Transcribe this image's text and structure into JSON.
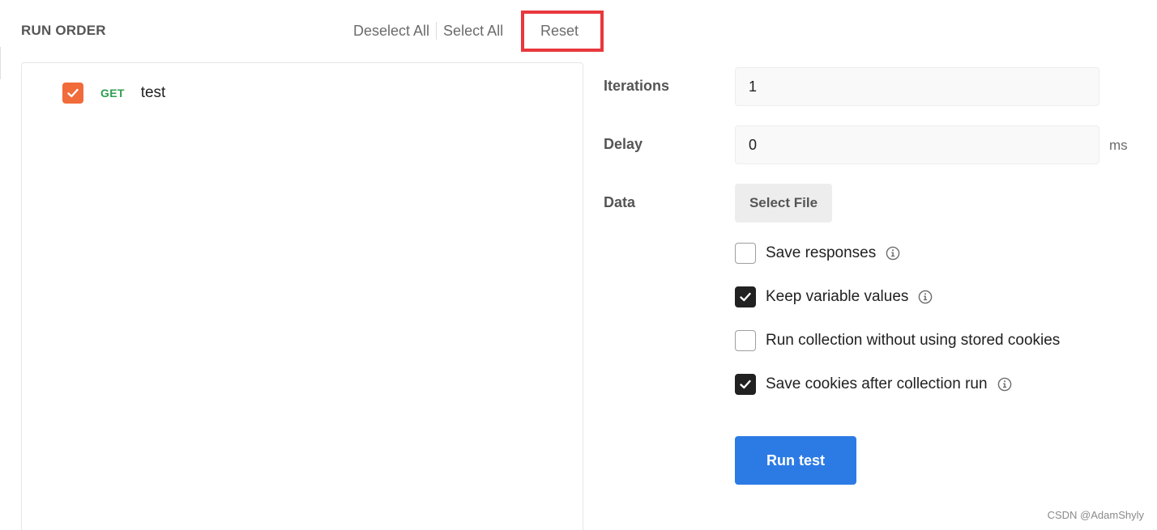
{
  "header": {
    "title": "RUN ORDER",
    "deselect_all": "Deselect All",
    "select_all": "Select All",
    "reset": "Reset"
  },
  "run_order": {
    "requests": [
      {
        "method": "GET",
        "name": "test",
        "checked": true
      }
    ]
  },
  "settings": {
    "iterations_label": "Iterations",
    "iterations_value": "1",
    "delay_label": "Delay",
    "delay_value": "0",
    "delay_unit": "ms",
    "data_label": "Data",
    "select_file": "Select File"
  },
  "options": [
    {
      "label": "Save responses",
      "checked": false,
      "info": true
    },
    {
      "label": "Keep variable values",
      "checked": true,
      "info": true
    },
    {
      "label": "Run collection without using stored cookies",
      "checked": false,
      "info": false
    },
    {
      "label": "Save cookies after collection run",
      "checked": true,
      "info": true
    }
  ],
  "run_button": "Run test",
  "watermark": "CSDN @AdamShyly",
  "colors": {
    "accent_blue": "#2c7be5",
    "orange": "#f26b3a",
    "get_green": "#2e9e4f",
    "highlight_red": "#e8383d"
  },
  "icons": {
    "check": "check-icon",
    "info": "info-icon"
  }
}
